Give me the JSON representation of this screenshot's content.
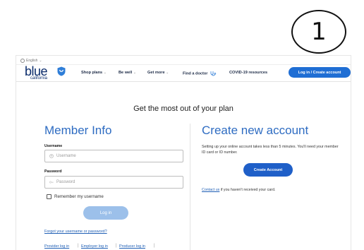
{
  "annotation": {
    "step_number": "1"
  },
  "header": {
    "language": "English",
    "logo_text": "blue",
    "logo_subtext": "california",
    "nav": [
      {
        "label": "Shop plans",
        "has_caret": true
      },
      {
        "label": "Be well",
        "has_caret": true
      },
      {
        "label": "Get more",
        "has_caret": true
      },
      {
        "label": "Find a doctor",
        "has_caret": false
      },
      {
        "label": "COVID-19 resources",
        "has_caret": false
      }
    ],
    "caret_glyph": "⌄",
    "login_button": "Log in / Create account"
  },
  "main": {
    "title": "Get the most out of your plan",
    "member": {
      "title": "Member Info",
      "username_label": "Username",
      "username_placeholder": "Username",
      "password_label": "Password",
      "password_placeholder": "Password",
      "remember_label": "Remember my username",
      "submit_label": "Log in",
      "forgot_link": "Forgot your username or password?",
      "bottom_links": [
        "Provider log in",
        "Employer log in",
        "Producer log in"
      ]
    },
    "create": {
      "title": "Create new account",
      "description": "Setting up your online account takes less than 5 minutes. You'll need your member ID card or ID number.",
      "button": "Create Account",
      "contact_link": "Contact us",
      "contact_text": " if you haven't received your card."
    }
  },
  "colors": {
    "primary_blue": "#1f6ed4",
    "heading_blue": "#2e6cc2",
    "brand_navy": "#0a2b6b",
    "disabled_button": "#9cc0ea"
  }
}
